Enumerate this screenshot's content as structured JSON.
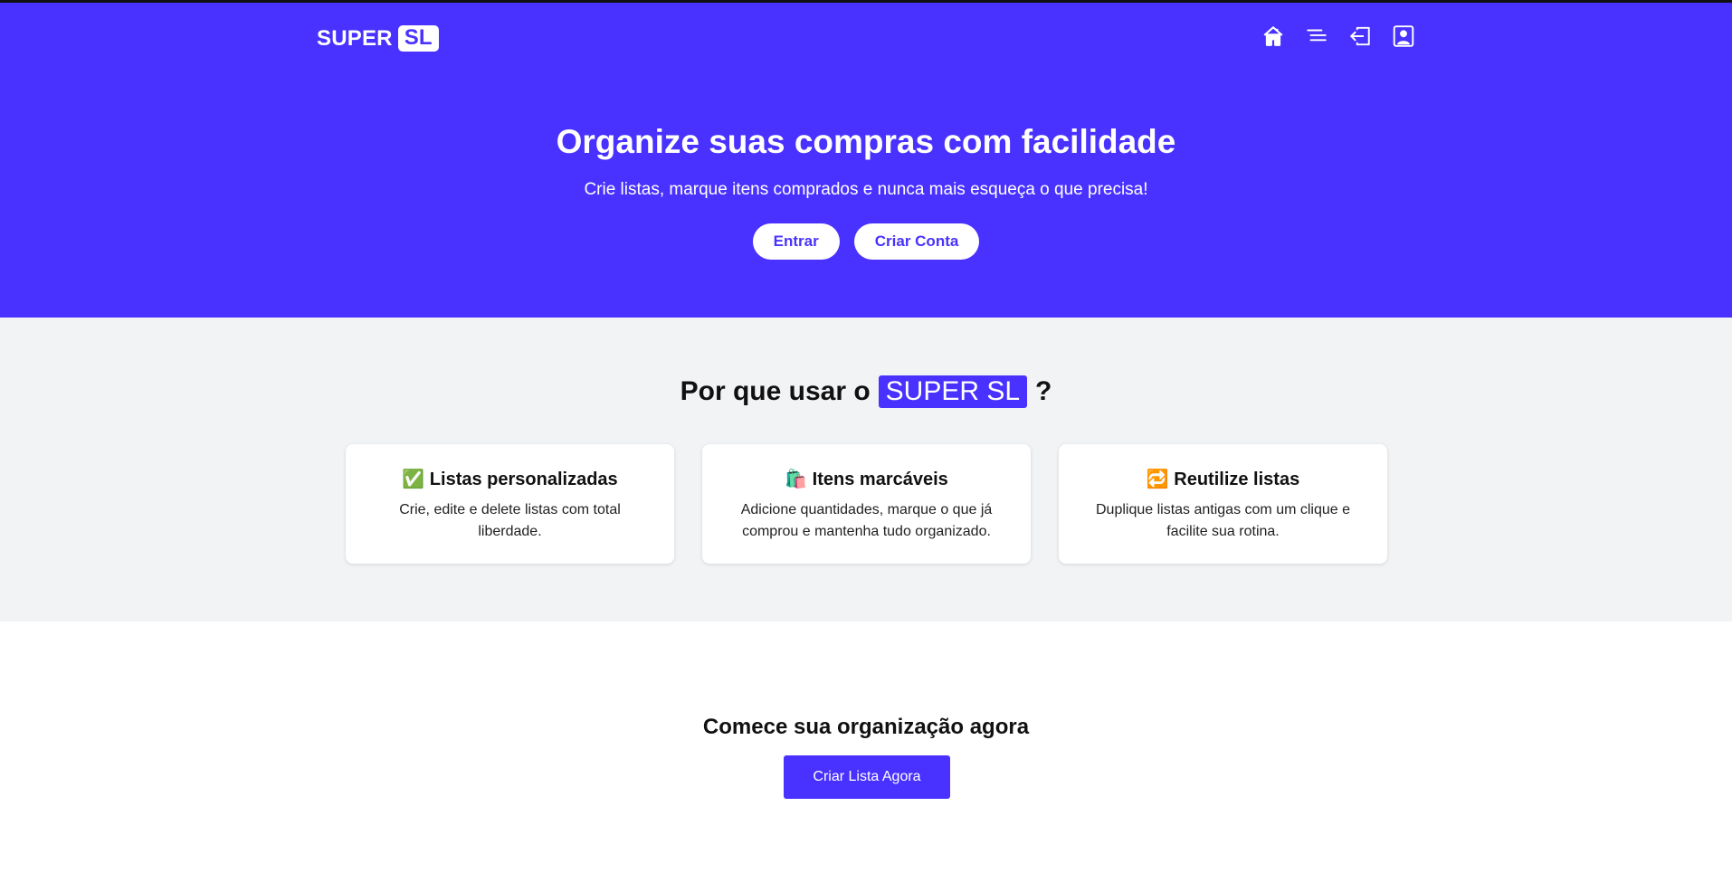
{
  "brand": {
    "name": "SUPER",
    "badge": "SL",
    "accent_color": "#4932ff"
  },
  "nav": {
    "icons": [
      "home-icon",
      "menu-icon",
      "login-icon",
      "user-icon"
    ]
  },
  "hero": {
    "title": "Organize suas compras com facilidade",
    "subtitle": "Crie listas, marque itens comprados e nunca mais esqueça o que precisa!",
    "login_label": "Entrar",
    "signup_label": "Criar Conta"
  },
  "features": {
    "title_prefix": "Por que usar o",
    "title_highlight": "SUPER SL",
    "title_suffix": "?",
    "cards": [
      {
        "emoji": "✅",
        "title": "Listas personalizadas",
        "text": "Crie, edite e delete listas com total liberdade."
      },
      {
        "emoji": "🛍️",
        "title": "Itens marcáveis",
        "text": "Adicione quantidades, marque o que já comprou e mantenha tudo organizado."
      },
      {
        "emoji": "🔁",
        "title": "Reutilize listas",
        "text": "Duplique listas antigas com um clique e facilite sua rotina."
      }
    ]
  },
  "cta": {
    "title": "Comece sua organização agora",
    "button_label": "Criar Lista Agora"
  }
}
